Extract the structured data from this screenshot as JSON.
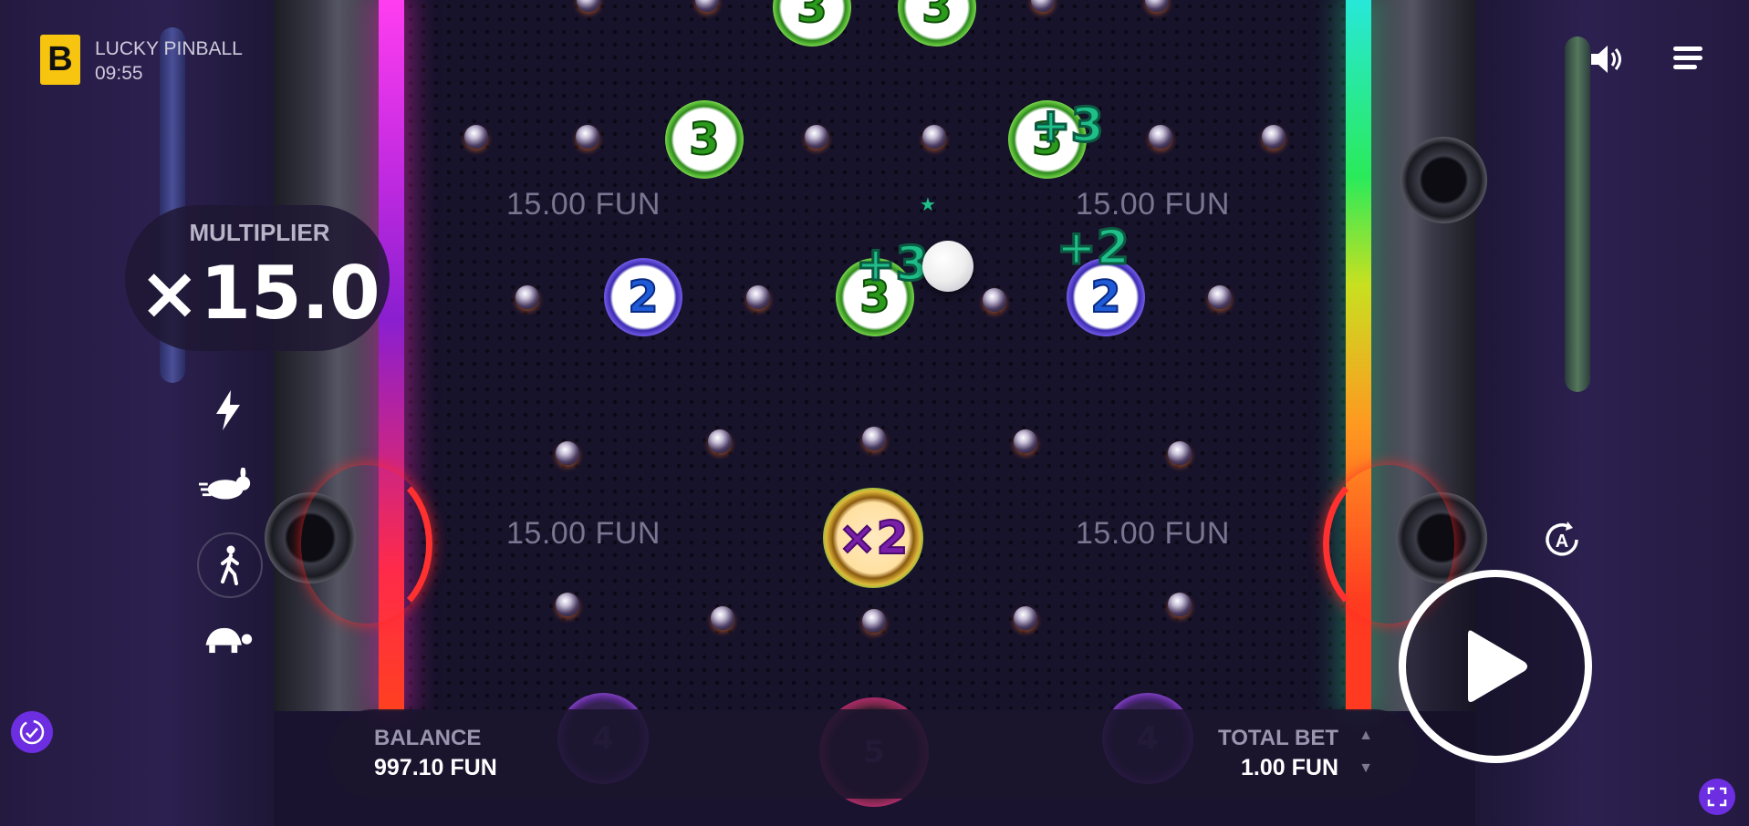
{
  "header": {
    "logo_letter": "B",
    "title": "LUCKY PINBALL",
    "clock": "09:55"
  },
  "multiplier": {
    "label": "MULTIPLIER",
    "value": "×15.0"
  },
  "speed_controls": [
    "lightning-icon",
    "rabbit-icon",
    "walking-person-icon",
    "turtle-icon"
  ],
  "speed_selected": "walking-person-icon",
  "board": {
    "prize_labels": [
      "15.00 FUN",
      "15.00 FUN",
      "15.00 FUN",
      "15.00 FUN"
    ],
    "top_bumpers": [
      "3",
      "3"
    ],
    "row1_bumpers": [
      "3",
      "3"
    ],
    "row2_bumpers": [
      "2",
      "3",
      "2"
    ],
    "center_bumper": "×2",
    "bonus_popups": [
      "+3",
      "+3",
      "+2"
    ],
    "bottom_slots": [
      "4",
      "5",
      "4"
    ]
  },
  "footer": {
    "balance_label": "BALANCE",
    "balance_value": "997.10 FUN",
    "bet_label": "TOTAL BET",
    "bet_value": "1.00 FUN",
    "bet_up": "▲",
    "bet_down": "▼"
  },
  "colors": {
    "background": "#1a1330",
    "logo": "#f7c510",
    "bonus_text": "#1fbf8a",
    "neon_left": "#ff3df0",
    "neon_right": "#2aea5a",
    "accent_button": "#6c2ee0"
  }
}
